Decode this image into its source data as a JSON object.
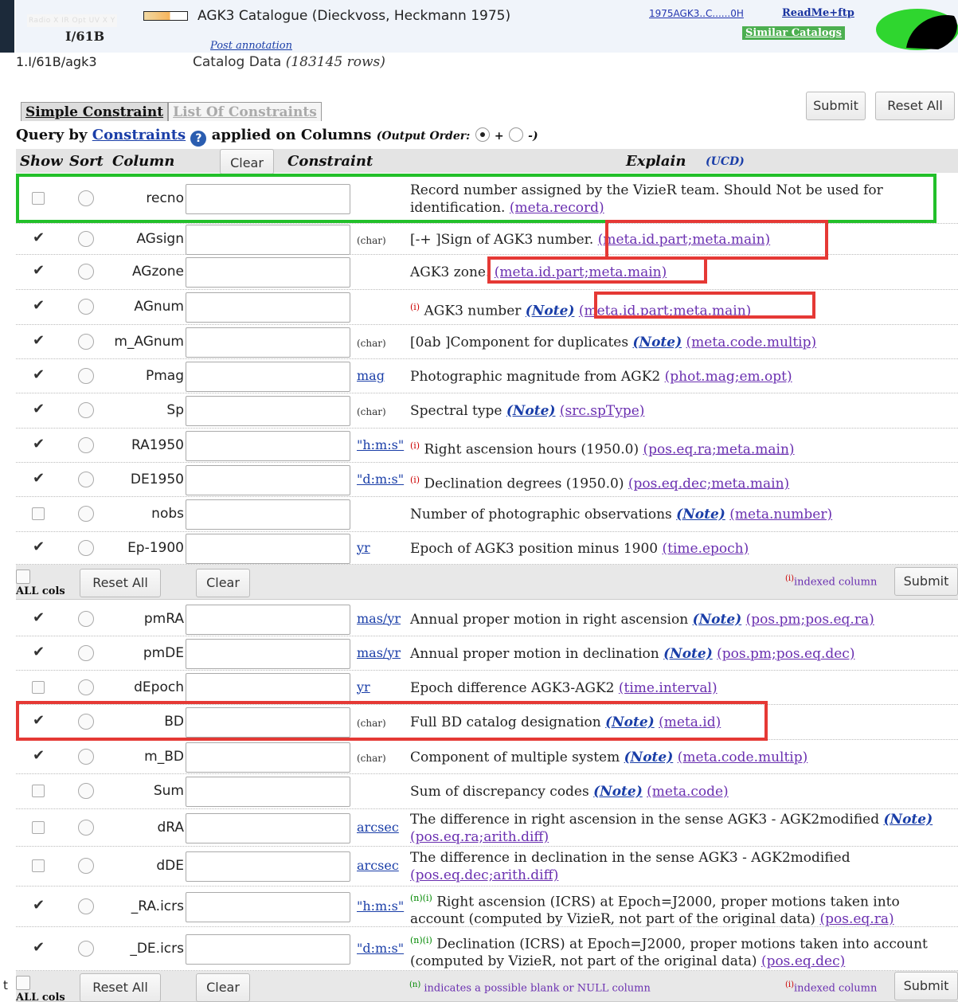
{
  "header": {
    "filters": "Radio X IR Opt UV X Y",
    "filter_active": "Opt",
    "catalog_id": "I/61B",
    "catalog_title": "AGK3 Catalogue (Dieckvoss, Heckmann 1975)",
    "bibcode": "1975AGK3..C......0H",
    "readme": "ReadMe+ftp",
    "similar": "Similar Catalogs",
    "annotation": "Post annotation",
    "table_name": "1.I/61B/agk3",
    "table_desc_prefix": "Catalog Data",
    "table_desc_rows": "(183145 rows)"
  },
  "left_fragment": "t",
  "tabs": [
    {
      "label": "Simple Constraint",
      "active": true
    },
    {
      "label": "List Of Constraints",
      "active": false
    }
  ],
  "top_buttons": {
    "submit": "Submit",
    "reset_all": "Reset All"
  },
  "query": {
    "prefix": "Query by",
    "link": "Constraints",
    "mid": "applied on Columns",
    "output_order": "(Output Order:",
    "plus": "+",
    "minus": "-)"
  },
  "col_header": {
    "show": "Show",
    "sort": "Sort",
    "column": "Column",
    "clear": "Clear",
    "constraint": "Constraint",
    "explain": "Explain",
    "ucd": "(UCD)"
  },
  "rows": [
    {
      "name": "recno",
      "checked": false,
      "unit": "",
      "pre": "Record number assigned by the VizieR team. Should Not be used for identification.",
      "note": "",
      "ucd": "(meta.record)"
    },
    {
      "name": "AGsign",
      "checked": true,
      "unit": "(char)",
      "pre": "[-+ ]Sign of AGK3 number.",
      "note": "",
      "ucd": "(meta.id.part;meta.main)"
    },
    {
      "name": "AGzone",
      "checked": true,
      "unit": "",
      "pre": "AGK3 zone.",
      "note": "",
      "ucd": "(meta.id.part;meta.main)"
    },
    {
      "name": "AGnum",
      "checked": true,
      "unit": "",
      "sup": "(i)",
      "pre": "AGK3 number",
      "note": "(Note)",
      "ucd": "(meta.id.part;meta.main)"
    },
    {
      "name": "m_AGnum",
      "checked": true,
      "unit": "(char)",
      "pre": "[0ab ]Component for duplicates",
      "note": "(Note)",
      "ucd": "(meta.code.multip)"
    },
    {
      "name": "Pmag",
      "checked": true,
      "unit": "mag",
      "pre": "Photographic magnitude from AGK2",
      "note": "",
      "ucd": "(phot.mag;em.opt)"
    },
    {
      "name": "Sp",
      "checked": true,
      "unit": "(char)",
      "pre": "Spectral type",
      "note": "(Note)",
      "ucd": "(src.spType)"
    },
    {
      "name": "RA1950",
      "checked": true,
      "unit": "\"h:m:s\"",
      "sup": "(i)",
      "pre": "Right ascension hours (1950.0)",
      "note": "",
      "ucd": "(pos.eq.ra;meta.main)"
    },
    {
      "name": "DE1950",
      "checked": true,
      "unit": "\"d:m:s\"",
      "sup": "(i)",
      "pre": "Declination degrees (1950.0)",
      "note": "",
      "ucd": "(pos.eq.dec;meta.main)"
    },
    {
      "name": "nobs",
      "checked": false,
      "unit": "",
      "pre": "Number of photographic observations",
      "note": "(Note)",
      "ucd": "(meta.number)"
    },
    {
      "name": "Ep-1900",
      "checked": true,
      "unit": "yr",
      "pre": "Epoch of AGK3 position minus 1900",
      "note": "",
      "ucd": "(time.epoch)"
    },
    {
      "name": "pmRA",
      "checked": true,
      "unit": "mas/yr",
      "pre": "Annual proper motion in right ascension",
      "note": "(Note)",
      "ucd": "(pos.pm;pos.eq.ra)"
    },
    {
      "name": "pmDE",
      "checked": true,
      "unit": "mas/yr",
      "pre": "Annual proper motion in declination",
      "note": "(Note)",
      "ucd": "(pos.pm;pos.eq.dec)"
    },
    {
      "name": "dEpoch",
      "checked": false,
      "unit": "yr",
      "pre": "Epoch difference AGK3-AGK2",
      "note": "",
      "ucd": "(time.interval)"
    },
    {
      "name": "BD",
      "checked": true,
      "unit": "(char)",
      "pre": "Full BD catalog designation",
      "note": "(Note)",
      "ucd": "(meta.id)"
    },
    {
      "name": "m_BD",
      "checked": true,
      "unit": "(char)",
      "pre": "Component of multiple system",
      "note": "(Note)",
      "ucd": "(meta.code.multip)"
    },
    {
      "name": "Sum",
      "checked": false,
      "unit": "",
      "pre": "Sum of discrepancy codes",
      "note": "(Note)",
      "ucd": "(meta.code)"
    },
    {
      "name": "dRA",
      "checked": false,
      "unit": "arcsec",
      "pre": "The difference in right ascension in the sense AGK3 - AGK2modified",
      "note": "(Note)",
      "ucd": "(pos.eq.ra;arith.diff)"
    },
    {
      "name": "dDE",
      "checked": false,
      "unit": "arcsec",
      "pre": "The difference in declination in the sense AGK3 - AGK2modified",
      "note": "",
      "ucd": "(pos.eq.dec;arith.diff)"
    },
    {
      "name": "_RA.icrs",
      "checked": true,
      "unit": "\"h:m:s\"",
      "sup": "(n)(i)",
      "pre": "Right ascension (ICRS) at Epoch=J2000, proper motions taken into account (computed by VizieR, not part of the original data)",
      "note": "",
      "ucd": "(pos.eq.ra)"
    },
    {
      "name": "_DE.icrs",
      "checked": true,
      "unit": "\"d:m:s\"",
      "sup": "(n)(i)",
      "pre": "Declination (ICRS) at Epoch=J2000, proper motions taken into account (computed by VizieR, not part of the original data)",
      "note": "",
      "ucd": "(pos.eq.dec)"
    }
  ],
  "footer": {
    "all_cols": "ALL cols",
    "reset_all": "Reset All",
    "clear": "Clear",
    "indexed_sup": "(i)",
    "indexed": "indexed column",
    "submit": "Submit",
    "null_sup": "(n)",
    "null_note": "indicates a possible blank or NULL column"
  },
  "colors": {
    "accent_link": "#1a3ea8",
    "ucd_link": "#6a2fb0",
    "highlight_red": "#e53935",
    "highlight_green": "#22c02a"
  }
}
